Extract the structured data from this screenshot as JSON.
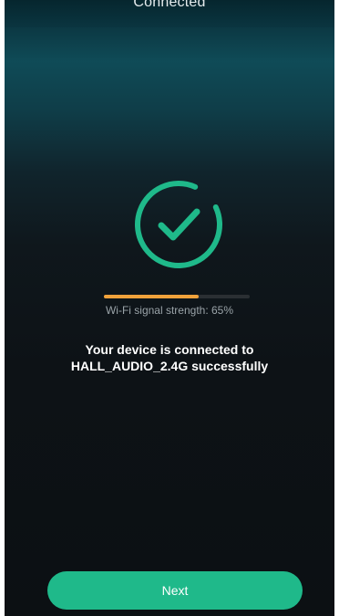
{
  "header": {
    "title": "Connected"
  },
  "status": {
    "icon": "check-circle-icon",
    "accent_color": "#1fb98a"
  },
  "signal": {
    "strength": 0.65,
    "label": "Wi-Fi signal strength: 65%",
    "fill_color": "#f0a23b"
  },
  "message": {
    "line1": "Your device is connected to",
    "line2": "HALL_AUDIO_2.4G successfully"
  },
  "actions": {
    "next_label": "Next"
  }
}
